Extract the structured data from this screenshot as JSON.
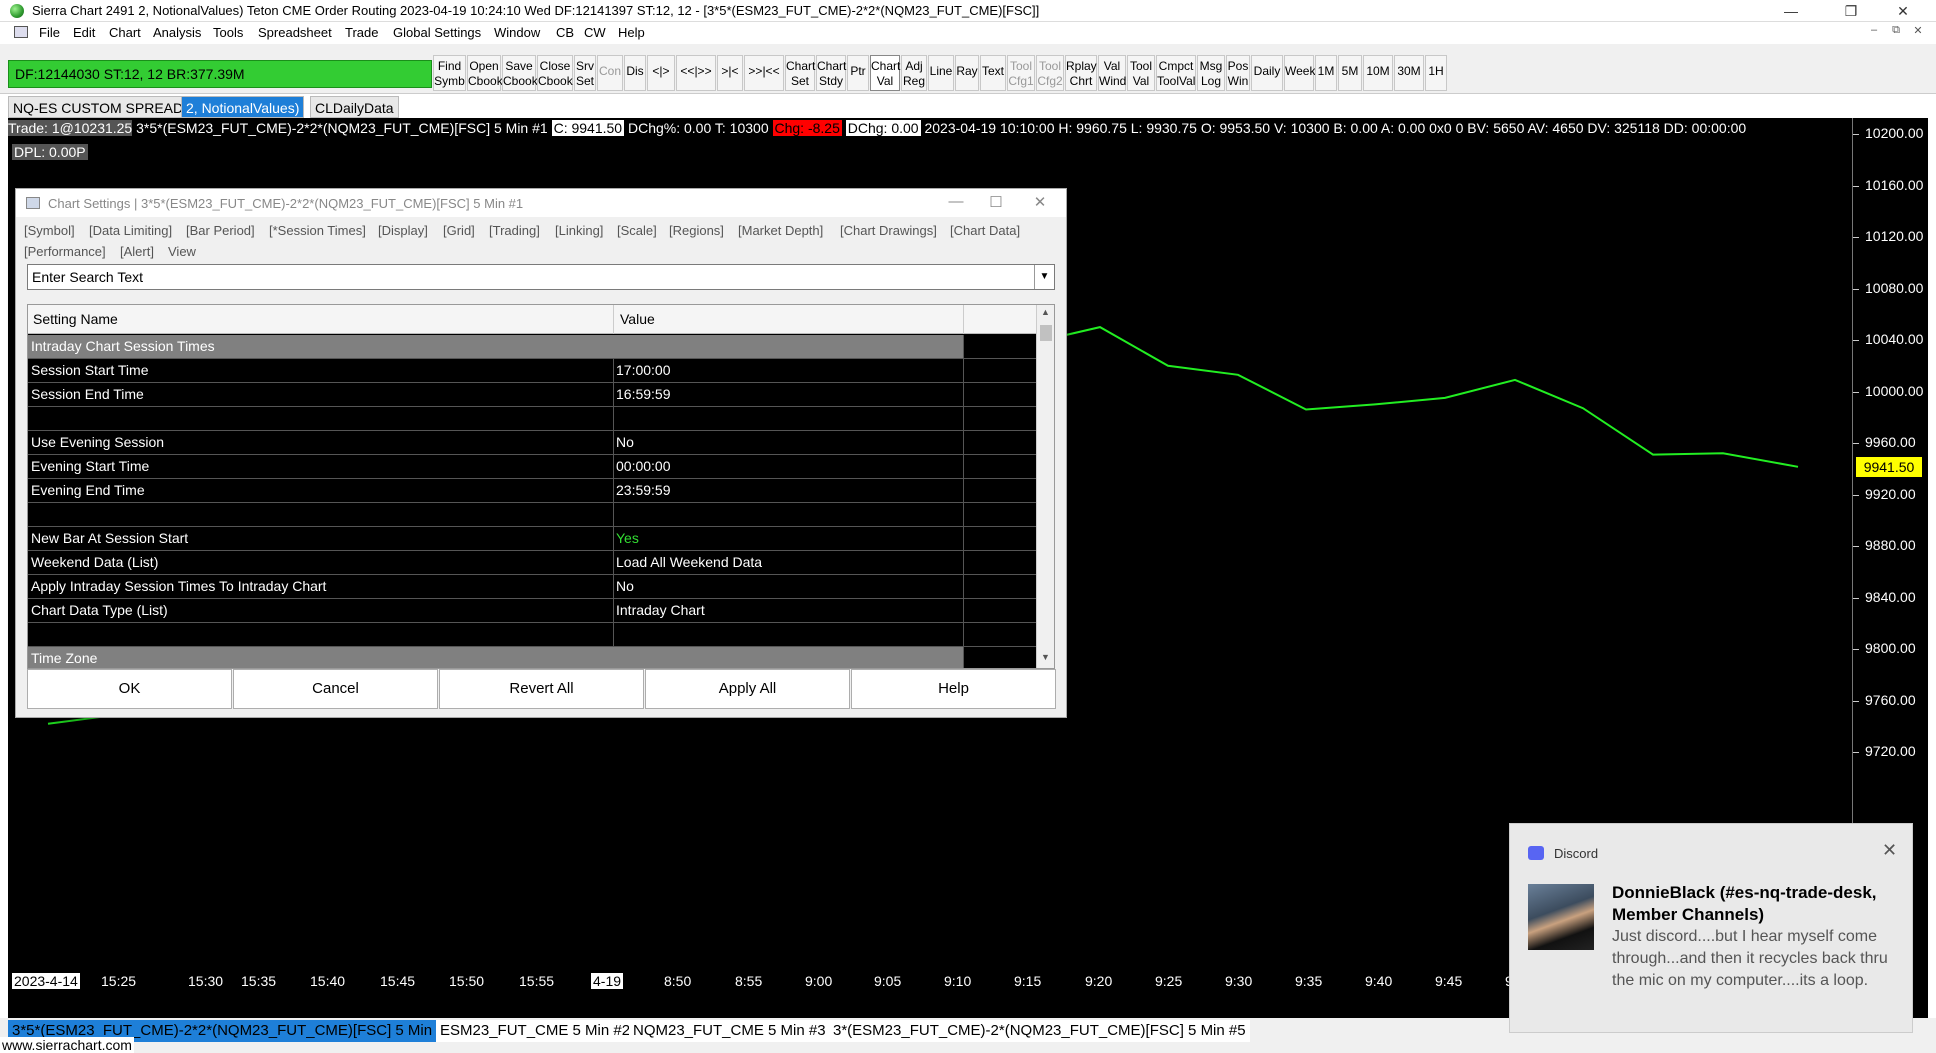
{
  "window": {
    "title": "Sierra Chart 2491 2, NotionalValues)   Teton CME Order Routing 2023-04-19  10:24:10 Wed   DF:12141397  ST:12, 12  - [3*5*(ESM23_FUT_CME)-2*2*(NQM23_FUT_CME)[FSC]]",
    "minimize": "—",
    "restore": "❐",
    "close": "✕"
  },
  "menu": {
    "items": [
      "File",
      "Edit",
      "Chart",
      "Analysis",
      "Tools",
      "Spreadsheet",
      "Trade",
      "Global Settings",
      "Window",
      "CB",
      "CW",
      "Help"
    ],
    "mdi_min": "–",
    "mdi_restore": "⧉",
    "mdi_close": "✕"
  },
  "status": {
    "text": "DF:12144030  ST:12, 12  BR:377.39M",
    "color": "#33cc33"
  },
  "toolbar": {
    "buttons": [
      {
        "l1": "Find",
        "l2": "Symb"
      },
      {
        "l1": "Open",
        "l2": "Cbook"
      },
      {
        "l1": "Save",
        "l2": "Cbook"
      },
      {
        "l1": "Close",
        "l2": "Cbook"
      },
      {
        "l1": "Srv",
        "l2": "Set"
      },
      {
        "l1": "Con",
        "l2": ""
      },
      {
        "l1": "Dis",
        "l2": ""
      },
      {
        "l1": "<|>",
        "l2": ""
      },
      {
        "l1": "<<|>>",
        "l2": ""
      },
      {
        "l1": ">|<",
        "l2": ""
      },
      {
        "l1": ">>|<<",
        "l2": ""
      },
      {
        "l1": "Chart",
        "l2": "Set"
      },
      {
        "l1": "Chart",
        "l2": "Stdy"
      },
      {
        "l1": "Ptr",
        "l2": ""
      },
      {
        "l1": "Chart",
        "l2": "Val"
      },
      {
        "l1": "Adj",
        "l2": "Reg"
      },
      {
        "l1": "Line",
        "l2": ""
      },
      {
        "l1": "Ray",
        "l2": ""
      },
      {
        "l1": "Text",
        "l2": ""
      },
      {
        "l1": "Tool",
        "l2": "Cfg1"
      },
      {
        "l1": "Tool",
        "l2": "Cfg2"
      },
      {
        "l1": "Rplay",
        "l2": "Chrt"
      },
      {
        "l1": "Val",
        "l2": "Wind"
      },
      {
        "l1": "Tool",
        "l2": "Val"
      },
      {
        "l1": "Cmpct",
        "l2": "ToolVal"
      },
      {
        "l1": "Msg",
        "l2": "Log"
      },
      {
        "l1": "Pos",
        "l2": "Win"
      },
      {
        "l1": "Daily",
        "l2": ""
      },
      {
        "l1": "Week",
        "l2": ""
      },
      {
        "l1": "1M",
        "l2": ""
      },
      {
        "l1": "5M",
        "l2": ""
      },
      {
        "l1": "10M",
        "l2": ""
      },
      {
        "l1": "30M",
        "l2": ""
      },
      {
        "l1": "1H",
        "l2": ""
      }
    ]
  },
  "chart_tabs": [
    "NQ-ES CUSTOM SPREAD",
    "2, NotionalValues)",
    "CLDailyData"
  ],
  "chart": {
    "info": {
      "trade": "Trade: 1@10231.25",
      "symbol": "3*5*(ESM23_FUT_CME)-2*2*(NQM23_FUT_CME)[FSC]  5 Min  #1",
      "close": "C: 9941.50",
      "dchg_pct": "DChg%: 0.00",
      "t": "T: 10300",
      "chg": "Chg: -8.25",
      "dchg": "DChg: 0.00",
      "rest": "2023-04-19 10:10:00  H: 9960.75  L: 9930.75  O: 9953.50  V: 10300  B: 0.00  A: 0.00  0x0  0  BV: 5650  AV: 4650  DV: 325118  DD: 00:00:00"
    },
    "dpl": "DPL: 0.00P",
    "y_labels": [
      "10200.00",
      "10160.00",
      "10120.00",
      "10080.00",
      "10040.00",
      "10000.00",
      "9960.00",
      "9920.00",
      "9880.00",
      "9840.00",
      "9800.00",
      "9760.00",
      "9720.00"
    ],
    "last_price": "9941.50",
    "line_color": "#22ee22",
    "x_labels": [
      "2023-4-14",
      "15:25",
      "15:30",
      "15:35",
      "15:40",
      "15:45",
      "15:50",
      "15:55",
      "4-19",
      "8:50",
      "8:55",
      "9:00",
      "9:05",
      "9:10",
      "9:15",
      "9:20",
      "9:25",
      "9:30",
      "9:35",
      "9:40",
      "9:45",
      "9:50"
    ]
  },
  "chart_data": {
    "type": "line",
    "ylim": [
      9700,
      10220
    ],
    "series": [
      {
        "x": [
          "2023-4-14",
          "15:25",
          "15:30",
          "15:35",
          "15:40",
          "9:15",
          "9:20",
          "9:25",
          "9:30",
          "9:35",
          "9:40",
          "9:45",
          "9:50",
          "9:55",
          "10:00",
          "10:05",
          "10:10"
        ],
        "values": [
          9742,
          9749,
          9766,
          9775,
          9778,
          10038,
          10050,
          10020,
          10013,
          9986,
          9990,
          9995,
          10009,
          9987,
          9951,
          9952,
          9941.5
        ]
      }
    ]
  },
  "dialog": {
    "title": "Chart Settings | 3*5*(ESM23_FUT_CME)-2*2*(NQM23_FUT_CME)[FSC]  5 Min   #1",
    "tabs_row1": [
      "[Symbol]",
      "[Data Limiting]",
      "[Bar Period]",
      "[*Session Times]",
      "[Display]",
      "[Grid]",
      "[Trading]",
      "[Linking]",
      "[Scale]",
      "[Regions]",
      "[Market Depth]",
      "[Chart Drawings]",
      "[Chart Data]"
    ],
    "tabs_row2": [
      "[Performance]",
      "[Alert]",
      "View"
    ],
    "search_value": "Enter Search Text",
    "col_setting": "Setting Name",
    "col_value": "Value",
    "rows": [
      {
        "name": "Intraday Chart Session Times",
        "value": "",
        "type": "section"
      },
      {
        "name": "Session Start Time",
        "value": "17:00:00",
        "type": "row"
      },
      {
        "name": "Session End Time",
        "value": "16:59:59",
        "type": "row"
      },
      {
        "name": "",
        "value": "",
        "type": "row"
      },
      {
        "name": "Use Evening Session",
        "value": "No",
        "type": "row"
      },
      {
        "name": "Evening Start Time",
        "value": "00:00:00",
        "type": "row"
      },
      {
        "name": "Evening End Time",
        "value": "23:59:59",
        "type": "row"
      },
      {
        "name": "",
        "value": "",
        "type": "row"
      },
      {
        "name": "New Bar At Session Start",
        "value": "Yes",
        "type": "row",
        "value_color": "#33dd33"
      },
      {
        "name": "Weekend Data (List)",
        "value": "Load All Weekend Data",
        "type": "row"
      },
      {
        "name": "Apply Intraday Session Times To Intraday Chart",
        "value": "No",
        "type": "row"
      },
      {
        "name": "Chart Data Type (List)",
        "value": "Intraday Chart",
        "type": "row"
      },
      {
        "name": "",
        "value": "",
        "type": "row"
      },
      {
        "name": "Time Zone",
        "value": "",
        "type": "section"
      }
    ],
    "buttons": {
      "ok": "OK",
      "cancel": "Cancel",
      "revert": "Revert All",
      "apply": "Apply All",
      "help": "Help"
    }
  },
  "bottom_tabs": [
    {
      "label": "3*5*(ESM23_FUT_CME)-2*2*(NQM23_FUT_CME)[FSC]  5 Min  #1",
      "active": true
    },
    {
      "label": "ESM23_FUT_CME  5 Min  #2",
      "active": false
    },
    {
      "label": "NQM23_FUT_CME  5 Min  #3",
      "active": false
    },
    {
      "label": "3*(ESM23_FUT_CME)-2*(NQM23_FUT_CME)[FSC]  5 Min  #5",
      "active": false
    }
  ],
  "url": "www.sierrachart.com",
  "notification": {
    "app": "Discord",
    "from": "DonnieBlack (#es-nq-trade-desk, Member Channels)",
    "message": "Just discord....but I hear myself come through...and then it recycles back thru the mic on my computer....its a loop.",
    "close": "✕"
  }
}
